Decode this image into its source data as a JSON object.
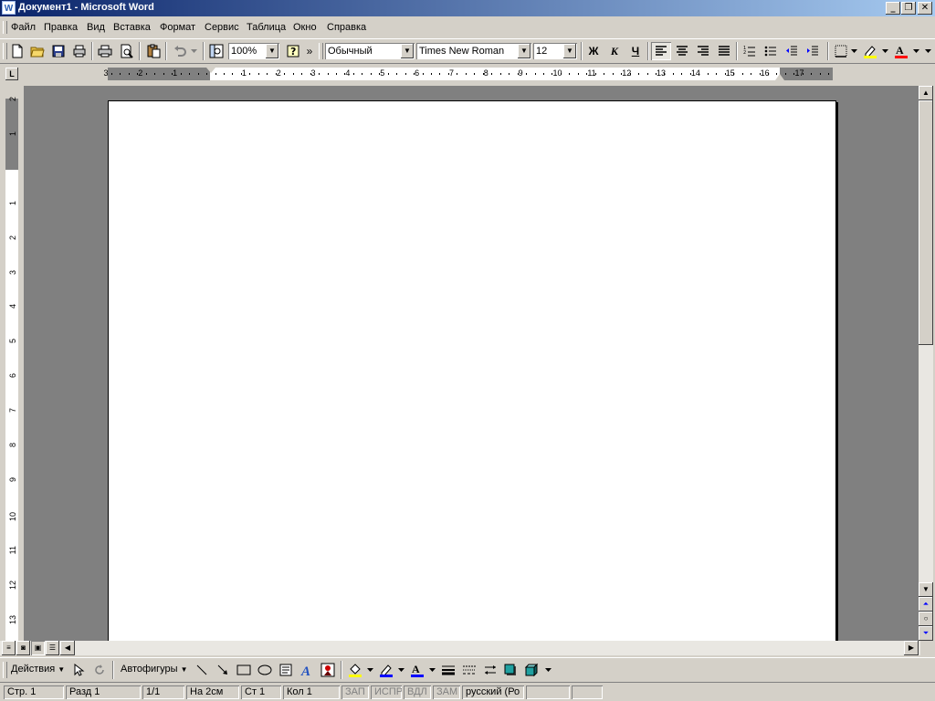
{
  "window": {
    "title": "Документ1 - Microsoft Word",
    "app_icon_letter": "W"
  },
  "menu": [
    "Файл",
    "Правка",
    "Вид",
    "Вставка",
    "Формат",
    "Сервис",
    "Таблица",
    "Окно",
    "Справка"
  ],
  "toolbar": {
    "zoom": "100%",
    "style": "Обычный",
    "font": "Times New Roman",
    "size": "12",
    "bold": "Ж",
    "italic": "К",
    "underline": "Ч",
    "overflow": "»"
  },
  "ruler": {
    "h_labels": [
      "3",
      "2",
      "1",
      "1",
      "2",
      "3",
      "4",
      "5",
      "6",
      "7",
      "8",
      "9",
      "10",
      "11",
      "12",
      "13",
      "14",
      "15",
      "16",
      "17"
    ],
    "v_labels": [
      "2",
      "1",
      "1",
      "2",
      "3",
      "4",
      "5",
      "6",
      "7",
      "8",
      "9",
      "10",
      "11",
      "12",
      "13"
    ]
  },
  "drawing": {
    "actions": "Действия",
    "autoshapes": "Автофигуры"
  },
  "status": {
    "page": "Стр. 1",
    "section": "Разд 1",
    "count": "1/1",
    "at": "На 2см",
    "line": "Ст 1",
    "col": "Кол 1",
    "rec": "ЗАП",
    "trk": "ИСПР",
    "ext": "ВДЛ",
    "ovr": "ЗАМ",
    "lang": "русский (Ро"
  },
  "colors": {
    "title_start": "#0a246a",
    "title_end": "#a6caf0",
    "workspace": "#808080",
    "face": "#d4d0c8"
  }
}
